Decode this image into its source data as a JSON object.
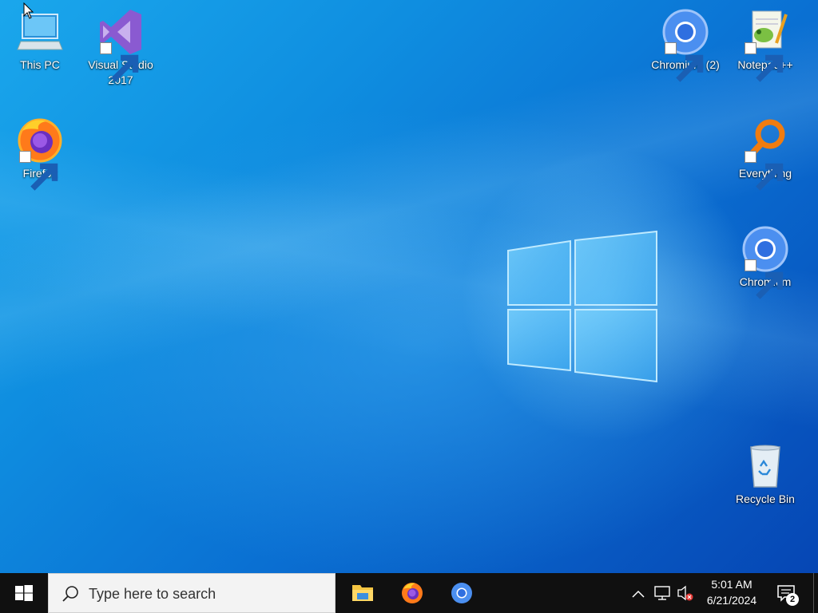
{
  "desktop": {
    "icons": [
      {
        "label": "This PC"
      },
      {
        "label": "Visual Studio 2017"
      },
      {
        "label": "Firefox"
      },
      {
        "label": "Chromium (2)"
      },
      {
        "label": "Notepad++"
      },
      {
        "label": "Everything"
      },
      {
        "label": "Chromium"
      },
      {
        "label": "Recycle Bin"
      }
    ]
  },
  "taskbar": {
    "search_placeholder": "Type here to search",
    "pinned_apps": [
      "file-explorer-icon",
      "firefox-icon",
      "chromium-icon"
    ],
    "clock": {
      "time": "5:01 AM",
      "date": "6/21/2024"
    },
    "notification_count": "2"
  },
  "colors": {
    "taskbar_bg": "#101010",
    "accent": "#0a6fd2"
  }
}
